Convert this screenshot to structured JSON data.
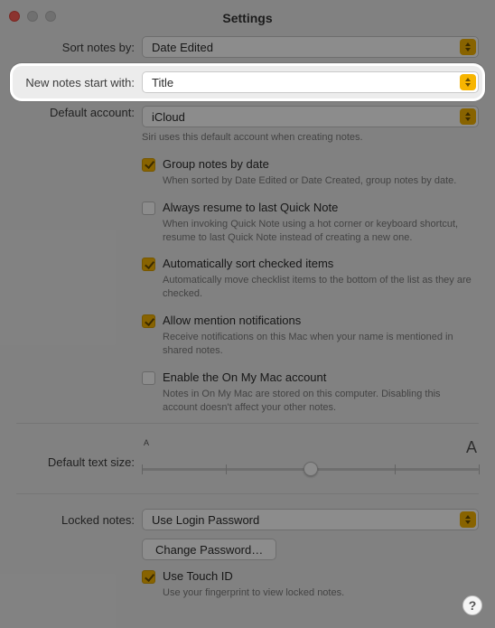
{
  "window": {
    "title": "Settings"
  },
  "form": {
    "sort_label": "Sort notes by:",
    "sort_value": "Date Edited",
    "start_label": "New notes start with:",
    "start_value": "Title",
    "default_acct_label": "Default account:",
    "default_acct_value": "iCloud",
    "default_acct_caption": "Siri uses this default account when creating notes."
  },
  "options": {
    "group": {
      "label": "Group notes by date",
      "caption": "When sorted by Date Edited or Date Created, group notes by date."
    },
    "resume": {
      "label": "Always resume to last Quick Note",
      "caption": "When invoking Quick Note using a hot corner or keyboard shortcut, resume to last Quick Note instead of creating a new one."
    },
    "autosort": {
      "label": "Automatically sort checked items",
      "caption": "Automatically move checklist items to the bottom of the list as they are checked."
    },
    "mentions": {
      "label": "Allow mention notifications",
      "caption": "Receive notifications on this Mac when your name is mentioned in shared notes."
    },
    "onmymac": {
      "label": "Enable the On My Mac account",
      "caption": "Notes in On My Mac are stored on this computer. Disabling this account doesn't affect your other notes."
    }
  },
  "textsize": {
    "label": "Default text size:",
    "small_glyph": "A",
    "large_glyph": "A",
    "ticks": 5,
    "value_index": 2
  },
  "locked": {
    "label": "Locked notes:",
    "value": "Use Login Password",
    "change_pw_label": "Change Password…",
    "touchid_label": "Use Touch ID",
    "touchid_caption": "Use your fingerprint to view locked notes."
  },
  "help_glyph": "?"
}
